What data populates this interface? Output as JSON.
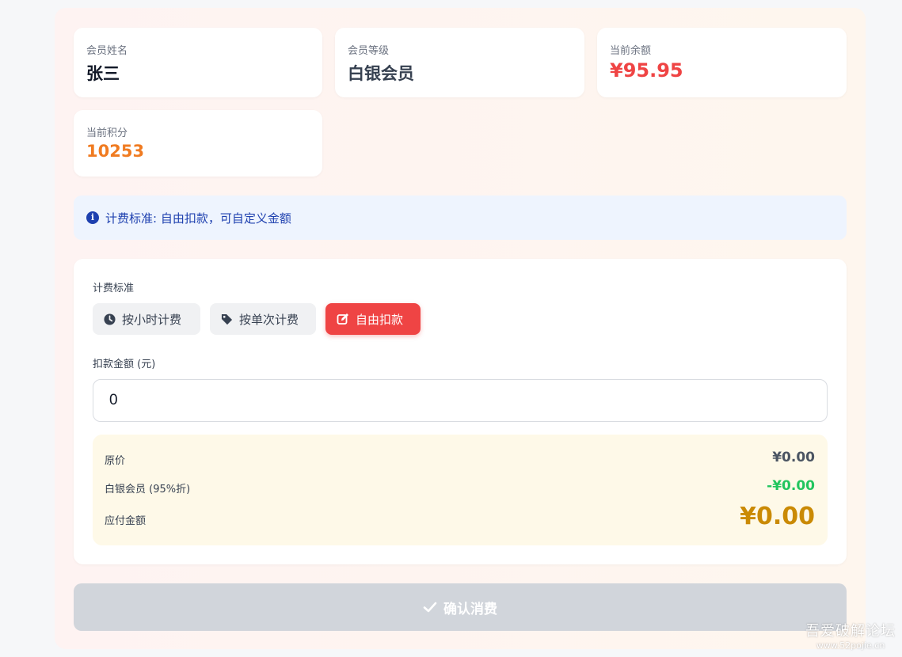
{
  "member": {
    "name_label": "会员姓名",
    "name_value": "张三",
    "level_label": "会员等级",
    "level_value": "白银会员",
    "balance_label": "当前余额",
    "balance_value": "¥95.95",
    "points_label": "当前积分",
    "points_value": "10253"
  },
  "info": {
    "icon": "info-circle-icon",
    "text": "计费标准: 自由扣款，可自定义金额"
  },
  "billing": {
    "section_label": "计费标准",
    "options": [
      {
        "label": "按小时计费",
        "icon": "clock-icon",
        "selected": false
      },
      {
        "label": "按单次计费",
        "icon": "tag-icon",
        "selected": false
      },
      {
        "label": "自由扣款",
        "icon": "edit-icon",
        "selected": true
      }
    ],
    "amount_label": "扣款金额 (元)",
    "amount_value": "0"
  },
  "summary": {
    "original_label": "原价",
    "original_value": "¥0.00",
    "discount_label": "白银会员 (95%折)",
    "discount_value": "-¥0.00",
    "payable_label": "应付金额",
    "payable_value": "¥0.00"
  },
  "confirm": {
    "label": "确认消费",
    "icon": "check-icon"
  },
  "watermark": {
    "line1": "吾爱破解论坛",
    "line2": "www.52pojie.cn"
  },
  "colors": {
    "accent_red": "#ef4444",
    "balance_red": "#ef4444",
    "points_orange": "#f07b21",
    "info_blue": "#1e40af",
    "discount_green": "#22c55e",
    "payable_gold": "#ca8a04",
    "disabled_gray": "#d1d5db"
  }
}
